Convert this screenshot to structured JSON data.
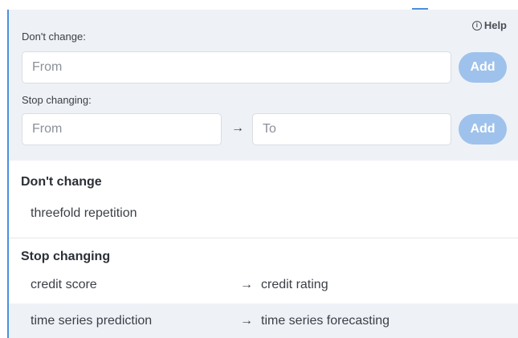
{
  "help": {
    "icon": "info-icon",
    "label": "Help"
  },
  "form": {
    "dont_change": {
      "label": "Don't change:",
      "from_placeholder": "From",
      "add_label": "Add"
    },
    "stop_changing": {
      "label": "Stop changing:",
      "from_placeholder": "From",
      "arrow": "→",
      "to_placeholder": "To",
      "add_label": "Add"
    }
  },
  "dont_change_list": {
    "title": "Don't change",
    "items": [
      "threefold repetition"
    ]
  },
  "stop_changing_list": {
    "title": "Stop changing",
    "rows": [
      {
        "from": "credit score",
        "arrow": "→",
        "to": "credit rating"
      },
      {
        "from": "time series prediction",
        "arrow": "→",
        "to": "time series forecasting"
      }
    ]
  },
  "colors": {
    "accent": "#4a8fe0",
    "add_button": "#9ec2eb",
    "panel_bg": "#eef2f7"
  }
}
